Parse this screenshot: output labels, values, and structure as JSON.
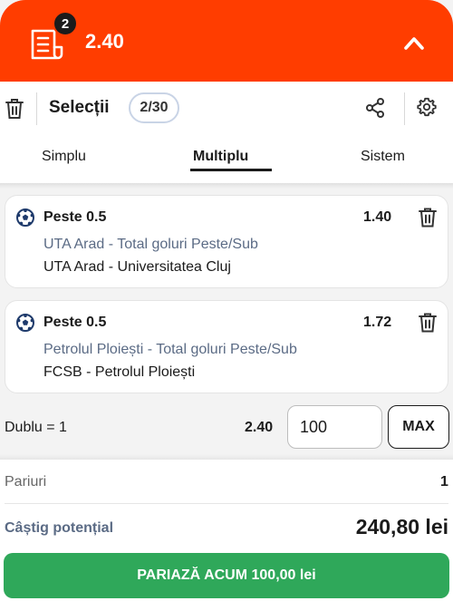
{
  "topbar": {
    "badge_count": "2",
    "total_odds": "2.40",
    "bg_color": "#ff3d00"
  },
  "header": {
    "title": "Selecții",
    "count": "2/30",
    "tabs": [
      {
        "label": "Simplu",
        "active": false
      },
      {
        "label": "Multiplu",
        "active": true
      },
      {
        "label": "Sistem",
        "active": false
      }
    ]
  },
  "selections": [
    {
      "market": "Peste 0.5",
      "odds": "1.40",
      "selection": "UTA Arad - Total goluri Peste/Sub",
      "event": "UTA Arad - Universitatea Cluj"
    },
    {
      "market": "Peste 0.5",
      "odds": "1.72",
      "selection": "Petrolul Ploiești - Total goluri Peste/Sub",
      "event": "FCSB - Petrolul Ploiești"
    }
  ],
  "stake": {
    "combo_label": "Dublu = 1",
    "combo_odds": "2.40",
    "value": "100",
    "max_label": "MAX"
  },
  "footer": {
    "bets_label": "Pariuri",
    "bets_value": "1",
    "win_label": "Câștig potențial",
    "win_value": "240,80 lei",
    "place_label": "PARIAZĂ ACUM 100,00 lei",
    "place_color": "#2fa85a"
  }
}
